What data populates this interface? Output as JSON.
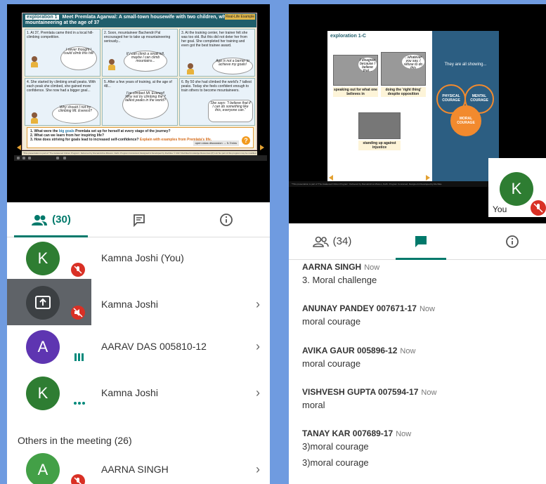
{
  "left": {
    "slide": {
      "tag": "exploration 1",
      "title": "Meet Premlata Agarwal: A small-town housewife with two children, who started mountaineering at the age of 37",
      "badge": "Real-Life Example",
      "panels": [
        {
          "text": "1. At 37, Premlata came third in a local hill-climbing competition.",
          "bubble": "I never thought I could climb this hill!"
        },
        {
          "text": "2. Soon, mountaineer Bachendri Pal encouraged her to take up mountaineering seriously...",
          "bubble": "If I can climb a small hill, maybe I can climb mountains..."
        },
        {
          "text": "3. At the training center, her trainer felt she was too old. But this did not deter her from her goal. She completed her training and even got the best trainee award.",
          "bubble": "Age is not a barrier to achieve my goals!"
        },
        {
          "text": "4. She started by climbing small peaks. With each peak she climbed, she gained more confidence. She now had a bigger goal...",
          "bubble": "Why should I not try climbing Mt. Everest?"
        },
        {
          "text": "5. After a few years of training, at the age of 48...",
          "bubble": "I've climbed Mt. Everest! Why not try climbing the 7 tallest peaks in the world?"
        },
        {
          "text": "6. By 50 she had climbed the world's 7 tallest peaks. Today she feels confident enough to train others to become mountaineers.",
          "bubble": "She says: \"I believe that if I can do something like this, everyone can.\""
        }
      ],
      "q1_pre": "1. What were the ",
      "q1_hi": "big goals",
      "q1_post": " Premlata set up for herself at every stage of the journey?",
      "q2": "2. What can we learn from her inspiring life?",
      "q3_pre": "3. How does striving for goals lead to increased self-confidence? ",
      "q3_hi": "Explain with examples from Premlata's life.",
      "hint": "open class discussion → 5-7mins",
      "footer": "*This presentation is part of 'The Awakened Citizen Program'. Delivered by Ramakrishna Mission, Delhi. Program Conceived, Designed & Developed by Ruchika. © 2017 Ruchika Knowledge Resources (P) Ltd. No part of this program may be modified or adapted without prior permission from Ruchika.",
      "qmark": "?"
    },
    "tabs": {
      "people_count": "(30)",
      "colors": {
        "active": "#00796b",
        "inactive": "#555555"
      }
    },
    "participants": [
      {
        "initial": "K",
        "name": "Kamna Joshi (You)",
        "color": "#2e7d32"
      },
      {
        "initial": "",
        "name": "Kamna Joshi",
        "color": "#3c4043"
      },
      {
        "initial": "A",
        "name": "AARAV DAS 005810-12",
        "color": "#5e35b1"
      },
      {
        "initial": "K",
        "name": "Kamna Joshi",
        "color": "#2e7d32"
      }
    ],
    "others_label": "Others in the meeting (26)",
    "others": [
      {
        "initial": "A",
        "name": "AARNA SINGH",
        "color": "#43a047"
      }
    ],
    "chevron": "›"
  },
  "right": {
    "slide": {
      "tag": "exploration ",
      "tag_num": "1-C",
      "photos": [
        {
          "label": "speaking out for what one believes in",
          "bubble": "I disagree because I believe that..."
        },
        {
          "label": "doing the 'right thing' despite opposition",
          "bubble": "...whatever you say, I refuse to do this"
        },
        {
          "label": "standing up against injustice",
          "bubble": ""
        }
      ],
      "blue_text": "They are all showing...",
      "circles": [
        "PHYSICAL COURAGE",
        "MENTAL COURAGE",
        "MORAL COURAGE"
      ],
      "footer": "*This presentation is part of 'The Awakened Citizen Program'. Delivered by Ramakrishna Mission, Delhi. Program Conceived, Designed & Developed by Ruchika."
    },
    "self_tile": {
      "initial": "K",
      "label": "You",
      "color": "#2e7d32"
    },
    "tabs": {
      "people_count": "(34)"
    },
    "messages": [
      {
        "sender": "AARNA SINGH",
        "time": "Now",
        "lines": [
          "3. Moral challenge"
        ]
      },
      {
        "sender": "ANUNAY PANDEY 007671-17",
        "time": "Now",
        "lines": [
          "moral courage"
        ]
      },
      {
        "sender": "AVIKA GAUR 005896-12",
        "time": "Now",
        "lines": [
          "moral courage"
        ]
      },
      {
        "sender": "VISHVESH GUPTA 007594-17",
        "time": "Now",
        "lines": [
          "moral"
        ]
      },
      {
        "sender": "TANAY KAR 007689-17",
        "time": "Now",
        "lines": [
          "3)moral courage",
          "3)moral courage"
        ]
      }
    ]
  }
}
